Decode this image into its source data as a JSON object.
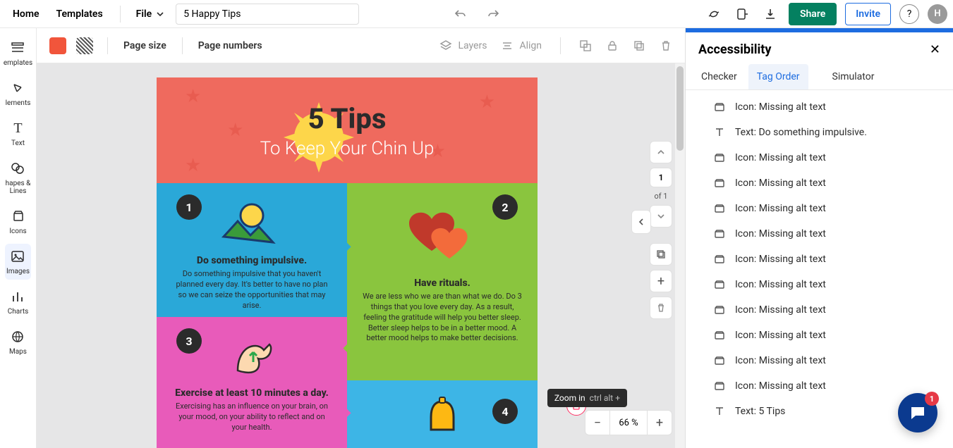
{
  "topbar": {
    "home": "Home",
    "templates": "Templates",
    "file": "File",
    "doc_title": "5 Happy Tips",
    "share": "Share",
    "invite": "Invite",
    "avatar": "H"
  },
  "rail": {
    "templates": "emplates",
    "elements": "lements",
    "text": "Text",
    "shapes": "hapes &\nLines",
    "icons": "Icons",
    "images": "Images",
    "charts": "Charts",
    "maps": "Maps"
  },
  "subbar": {
    "page_size": "Page size",
    "page_numbers": "Page numbers",
    "layers": "Layers",
    "align": "Align"
  },
  "doc": {
    "title1_num": "5",
    "title1_rest": "Tips",
    "title2": "To Keep Your Chin Up",
    "cells": [
      {
        "num": "1",
        "h": "Do something impulsive.",
        "p": "Do something impulsive that you haven't planned every day. It's better to have no plan so we can seize the opportunities that may arise."
      },
      {
        "num": "2",
        "h": "Have rituals.",
        "p": "We are less who we are than what we do. Do 3 things that you love every day. As a result, feeling the gratitude will help you better sleep. Better sleep helps to be in a better mood. A better mood helps to make better decisions."
      },
      {
        "num": "3",
        "h": "Exercise at least 10 minutes a day.",
        "p": "Exercising has an influence on your brain, on your mood, on your ability to reflect and on your health."
      },
      {
        "num": "4",
        "h": "",
        "p": ""
      }
    ]
  },
  "paging": {
    "current": "1",
    "of": "of 1"
  },
  "zoom": {
    "value": "66 %",
    "tooltip_label": "Zoom in",
    "tooltip_keys": "ctrl alt +"
  },
  "a11y": {
    "title": "Accessibility",
    "tabs": {
      "checker": "Checker",
      "tag_order": "Tag Order",
      "simulator": "Simulator"
    },
    "items": [
      {
        "type": "icon",
        "label": "Icon: Missing alt text"
      },
      {
        "type": "text",
        "label": "Text: Do something impulsive."
      },
      {
        "type": "icon",
        "label": "Icon: Missing alt text"
      },
      {
        "type": "icon",
        "label": "Icon: Missing alt text"
      },
      {
        "type": "icon",
        "label": "Icon: Missing alt text"
      },
      {
        "type": "icon",
        "label": "Icon: Missing alt text"
      },
      {
        "type": "icon",
        "label": "Icon: Missing alt text"
      },
      {
        "type": "icon",
        "label": "Icon: Missing alt text"
      },
      {
        "type": "icon",
        "label": "Icon: Missing alt text"
      },
      {
        "type": "icon",
        "label": "Icon: Missing alt text"
      },
      {
        "type": "icon",
        "label": "Icon: Missing alt text"
      },
      {
        "type": "icon",
        "label": "Icon: Missing alt text"
      },
      {
        "type": "text",
        "label": "Text: 5 Tips"
      }
    ]
  },
  "chat_badge": "1"
}
